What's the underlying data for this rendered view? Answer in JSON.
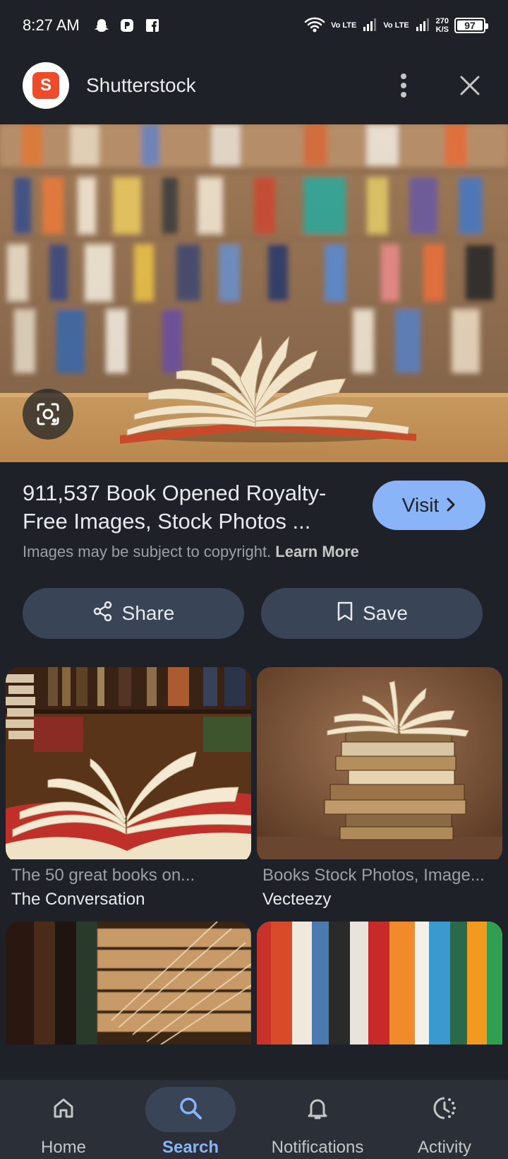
{
  "status_bar": {
    "time": "8:27 AM",
    "network_1": "Vo LTE",
    "network_2": "Vo LTE",
    "speed_value": "270",
    "speed_unit": "K/S",
    "battery": "97"
  },
  "header": {
    "site_name": "Shutterstock",
    "logo_letter": "S"
  },
  "result": {
    "title": "911,537 Book Opened Royalty-Free Images, Stock Photos ...",
    "visit_label": "Visit",
    "copyright_text": "Images may be subject to copyright.",
    "learn_more": "Learn More"
  },
  "actions": {
    "share_label": "Share",
    "save_label": "Save"
  },
  "related": [
    {
      "title": "The 50 great books on...",
      "source": "The Conversation"
    },
    {
      "title": "Books Stock Photos, Image...",
      "source": "Vecteezy"
    }
  ],
  "bottom_nav": {
    "items": [
      {
        "label": "Home",
        "icon": "home-icon",
        "active": false
      },
      {
        "label": "Search",
        "icon": "search-icon",
        "active": true
      },
      {
        "label": "Notifications",
        "icon": "bell-icon",
        "active": false
      },
      {
        "label": "Activity",
        "icon": "activity-icon",
        "active": false
      }
    ]
  },
  "colors": {
    "background": "#1f2128",
    "accent": "#8ab4f8",
    "button_bg": "#394457",
    "brand": "#ee4b2b"
  }
}
